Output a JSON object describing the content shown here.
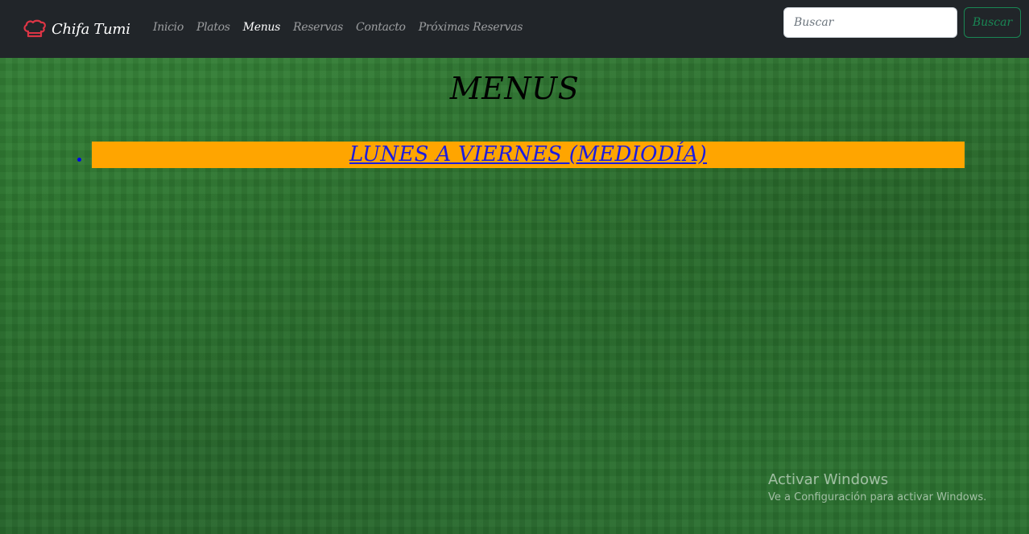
{
  "brand": {
    "name": "Chifa Tumi",
    "icon": "chef-hat-icon",
    "icon_color": "#dc3545"
  },
  "nav": {
    "links": [
      {
        "label": "Inicio",
        "active": false
      },
      {
        "label": "Platos",
        "active": false
      },
      {
        "label": "Menus",
        "active": true
      },
      {
        "label": "Reservas",
        "active": false
      },
      {
        "label": "Contacto",
        "active": false
      },
      {
        "label": "Próximas Reservas",
        "active": false
      }
    ]
  },
  "search": {
    "placeholder": "Buscar",
    "value": "",
    "button_label": "Buscar",
    "button_color": "#198754"
  },
  "main": {
    "title": "MENUS",
    "menu_items": [
      {
        "label": "LUNES A VIERNES (MEDIODÍA)"
      }
    ],
    "item_background": "#ffa500",
    "link_color": "#1c1cdf"
  },
  "watermark": {
    "title": "Activar Windows",
    "subtitle": "Ve a Configuración para activar Windows."
  }
}
